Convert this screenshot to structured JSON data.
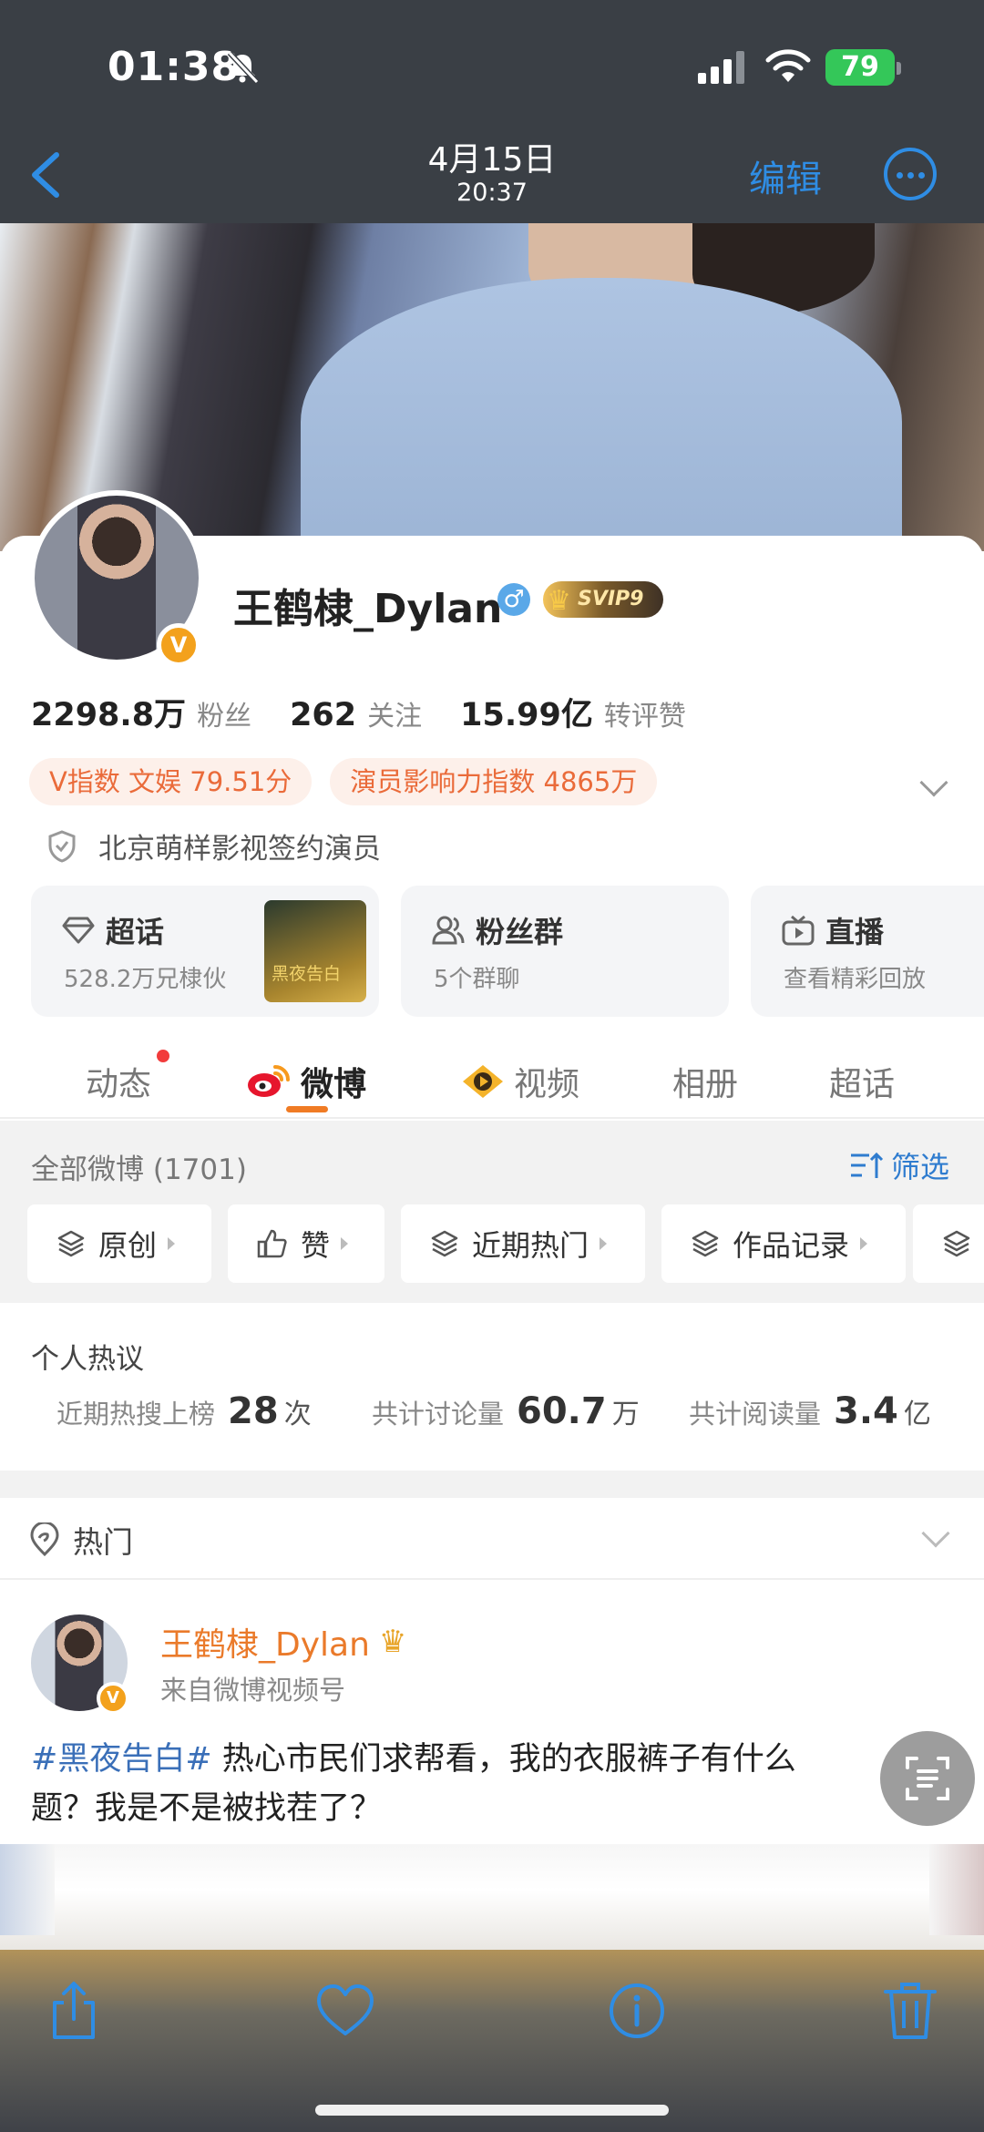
{
  "status_bar": {
    "time": "01:38",
    "battery": "79"
  },
  "nav": {
    "date": "4月15日",
    "time": "20:37",
    "edit_label": "编辑"
  },
  "profile": {
    "username": "王鹤棣_Dylan",
    "gender_symbol": "♂",
    "svip_label": "SVIP9",
    "verified_mark": "V",
    "stats": [
      {
        "num": "2298.8万",
        "label": "粉丝"
      },
      {
        "num": "262",
        "label": "关注"
      },
      {
        "num": "15.99亿",
        "label": "转评赞"
      }
    ],
    "tags": [
      "V指数 文娱 79.51分",
      "演员影响力指数 4865万"
    ],
    "signed": "北京萌样影视签约演员"
  },
  "features": [
    {
      "title": "超话",
      "sub": "528.2万兄棣伙"
    },
    {
      "title": "粉丝群",
      "sub": "5个群聊"
    },
    {
      "title": "直播",
      "sub": "查看精彩回放"
    }
  ],
  "poster_text": "黑夜告白",
  "tabs": [
    "动态",
    "微博",
    "视频",
    "相册",
    "超话"
  ],
  "feed": {
    "all_count": "全部微博 (1701)",
    "filter_label": "筛选",
    "chips": [
      "原创",
      "赞",
      "近期热门",
      "作品记录"
    ]
  },
  "hot_topics": {
    "title": "个人热议",
    "stats": [
      {
        "label": "近期热搜上榜",
        "num": "28",
        "unit": "次"
      },
      {
        "label": "共计讨论量",
        "num": "60.7",
        "unit": "万"
      },
      {
        "label": "共计阅读量",
        "num": "3.4",
        "unit": "亿"
      }
    ]
  },
  "hot_section": {
    "title": "热门"
  },
  "post": {
    "name": "王鹤棣_Dylan",
    "source": "来自微博视频号",
    "hashtag": "#黑夜告白#",
    "text_line1": " 热心市民们求帮看，我的衣服裤子有什么",
    "text_line2": "题？我是不是被找茬了？"
  },
  "colors": {
    "accent_blue": "#2f8de4",
    "orange": "#ea7a2a",
    "tag_bg": "#fdf0ea",
    "tag_text": "#ea6b3a"
  },
  "icons": [
    "mute-icon",
    "signal-icon",
    "wifi-icon",
    "back-chevron-icon",
    "more-icon",
    "shield-icon",
    "diamond-icon",
    "fans-icon",
    "tv-icon",
    "weibo-eye-icon",
    "video-play-icon",
    "filter-icon",
    "layers-icon",
    "thumb-icon",
    "location-pin-icon",
    "crown-icon",
    "scan-icon",
    "share-icon",
    "heart-icon",
    "info-icon",
    "trash-icon"
  ]
}
